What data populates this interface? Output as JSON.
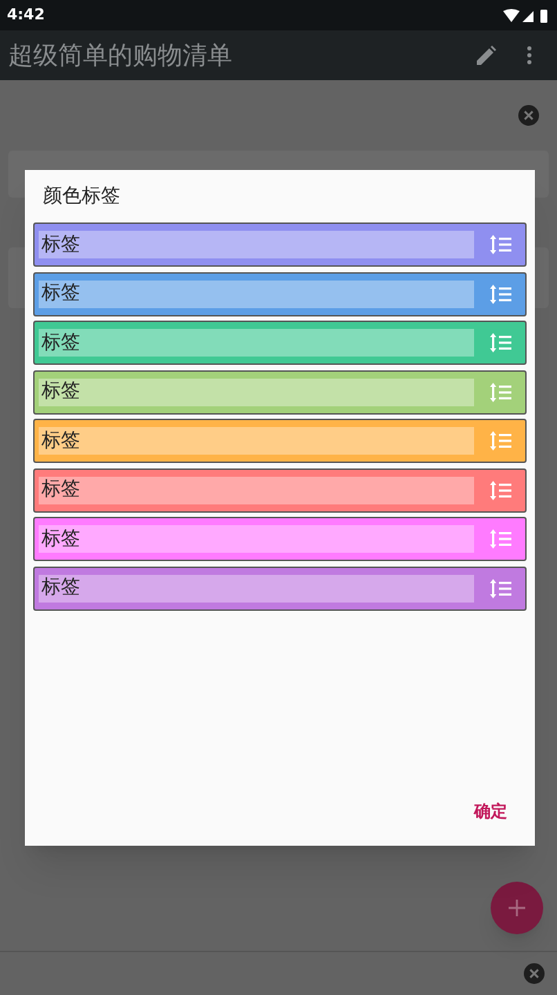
{
  "status_bar": {
    "time": "4:42"
  },
  "app_bar": {
    "title": "超级简单的购物清单"
  },
  "dialog": {
    "title": "颜色标签",
    "tags": [
      {
        "value": "标签",
        "color": "#8f8ff0"
      },
      {
        "value": "标签",
        "color": "#5c9ee6"
      },
      {
        "value": "标签",
        "color": "#40c994"
      },
      {
        "value": "标签",
        "color": "#a3d17a"
      },
      {
        "value": "标签",
        "color": "#ffb347"
      },
      {
        "value": "标签",
        "color": "#ff7b7b"
      },
      {
        "value": "标签",
        "color": "#ff7bff"
      },
      {
        "value": "标签",
        "color": "#c07ae0"
      }
    ],
    "confirm": "确定"
  }
}
